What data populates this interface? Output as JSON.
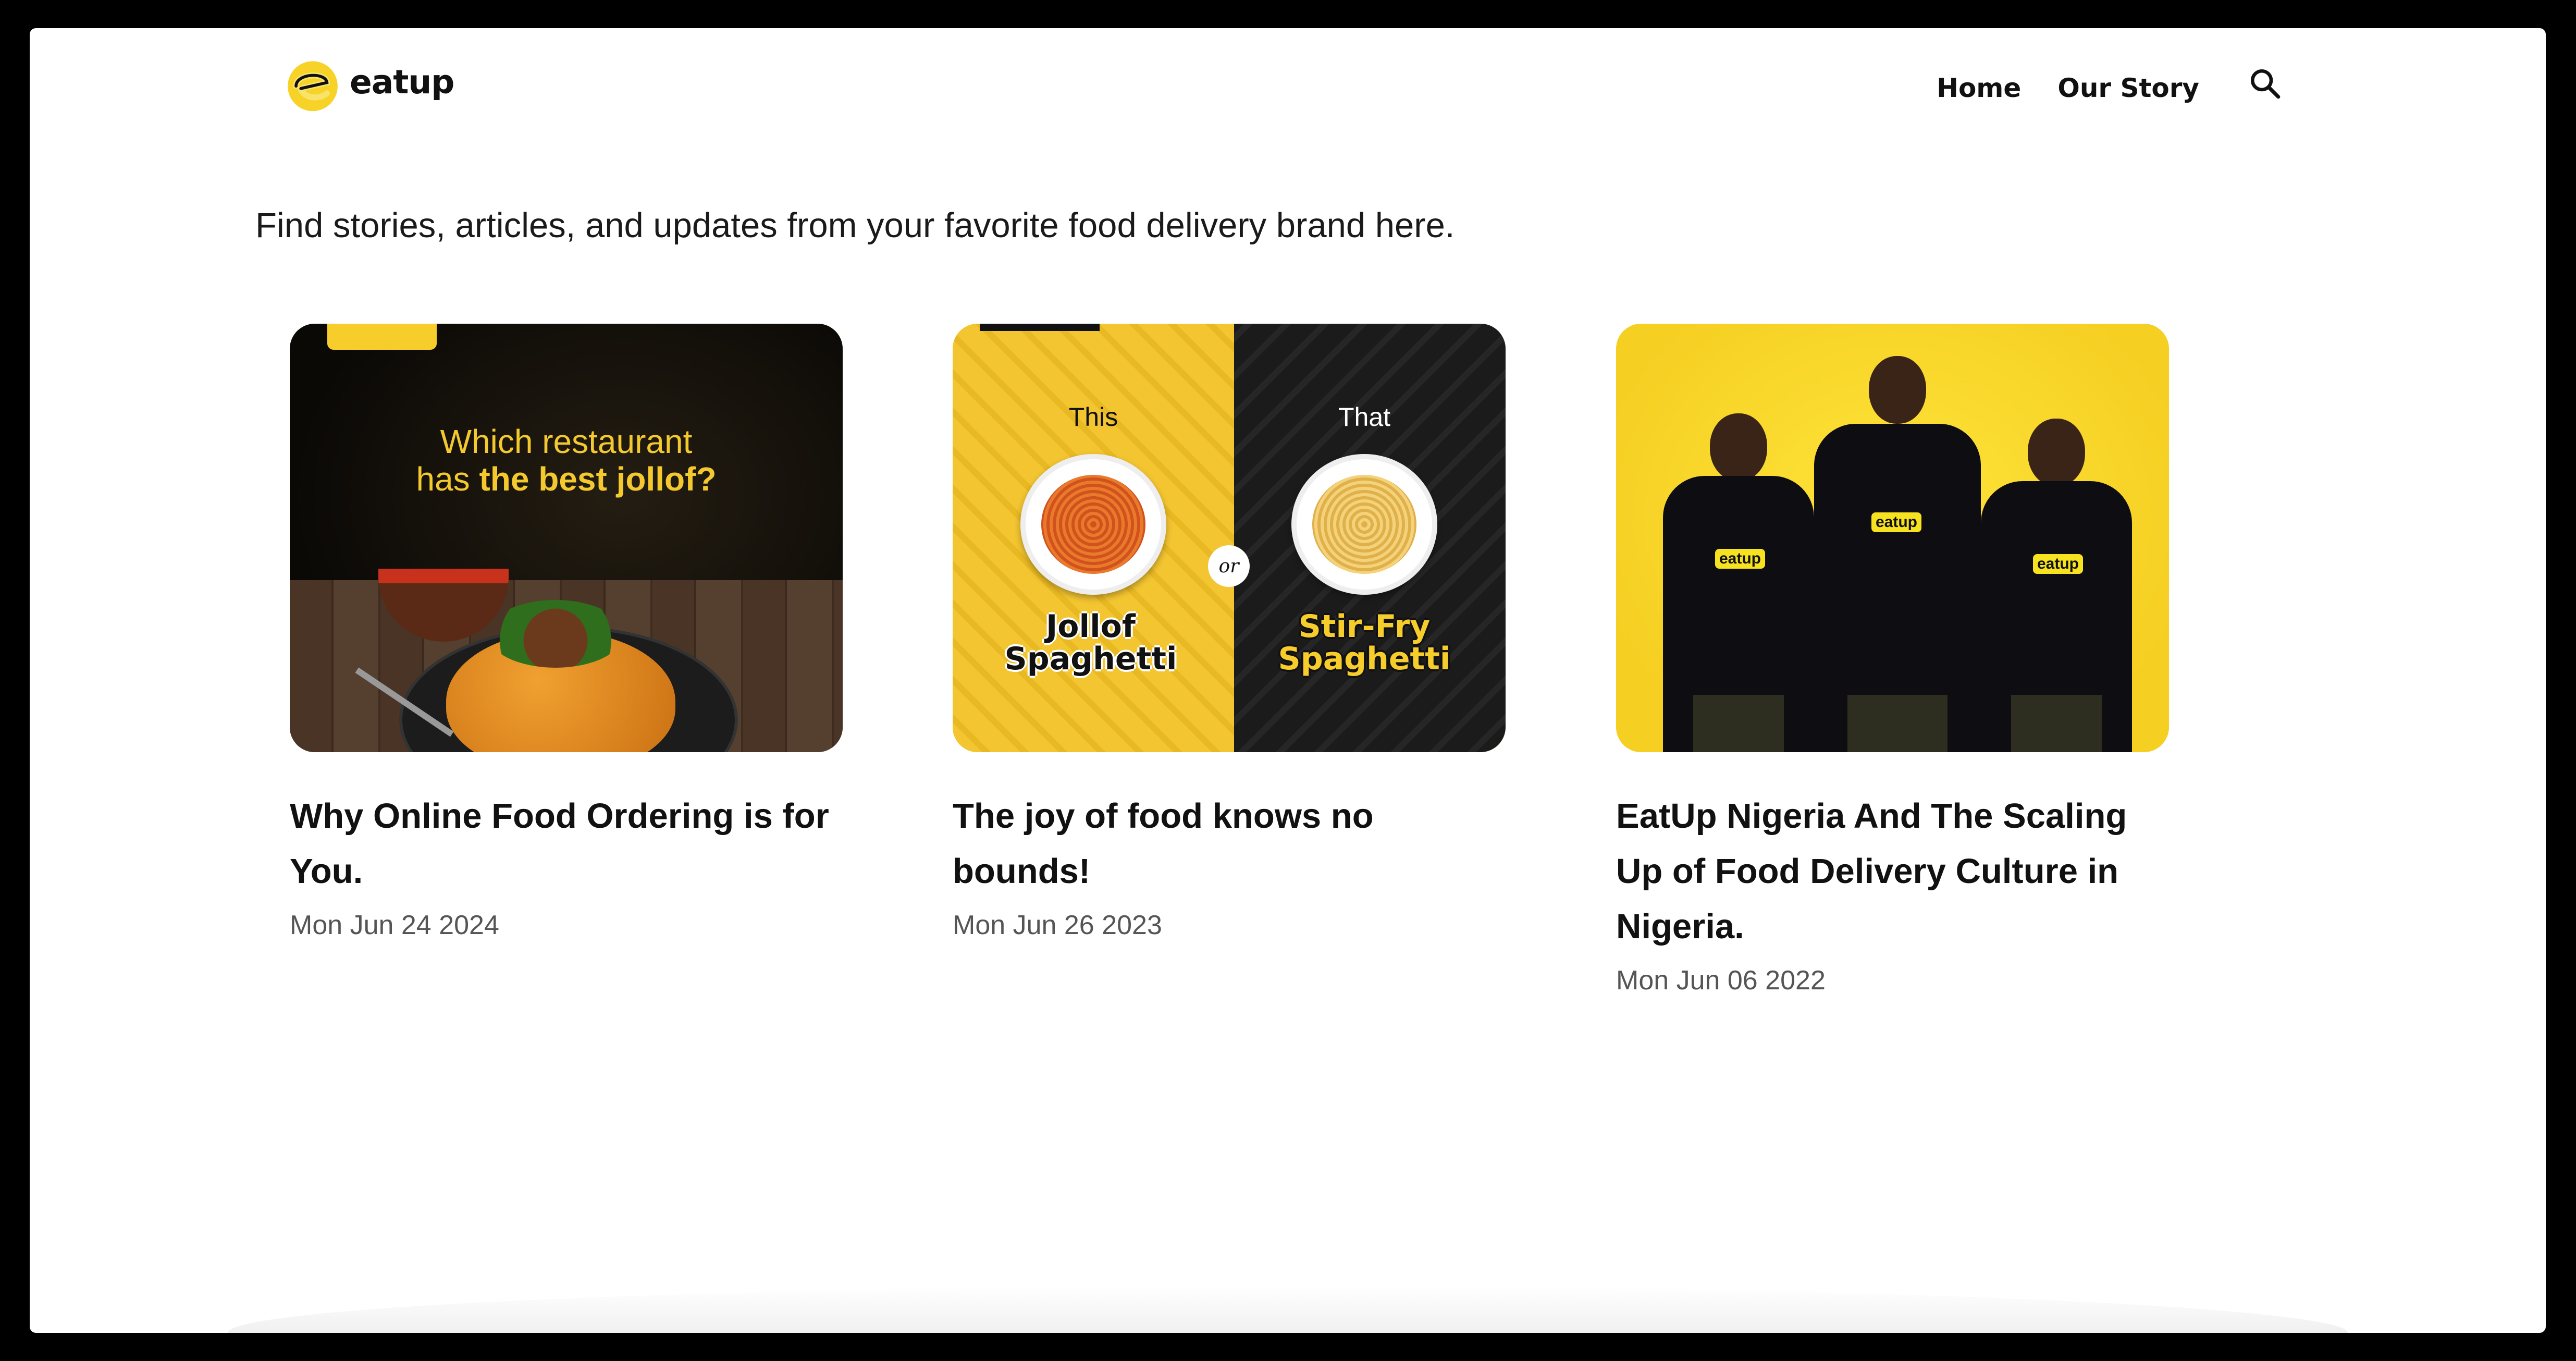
{
  "brand": {
    "name": "eatup",
    "accent": "#f7cd2c"
  },
  "nav": {
    "items": [
      {
        "label": "Home"
      },
      {
        "label": "Our Story"
      }
    ],
    "search_icon": "search-icon"
  },
  "intro": "Find stories, articles, and updates from your favorite food delivery brand here.",
  "posts": [
    {
      "title": "Why Online Food Ordering is for You.",
      "date": "Mon Jun 24 2024",
      "image_text": {
        "line1": "Which restaurant",
        "line2_prefix": "has ",
        "line2_bold": "the best jollof?"
      }
    },
    {
      "title": "The joy of food knows no bounds!",
      "date": "Mon Jun 26 2023",
      "image_text": {
        "left_label": "This",
        "right_label": "That",
        "or": "or",
        "left_dish": "Jollof Spaghetti",
        "right_dish": "Stir-Fry Spaghetti"
      }
    },
    {
      "title": "EatUp Nigeria And The Scaling Up of Food Delivery Culture in Nigeria.",
      "date": "Mon Jun 06 2022",
      "image_text": {
        "shirt": "eatup"
      }
    }
  ]
}
